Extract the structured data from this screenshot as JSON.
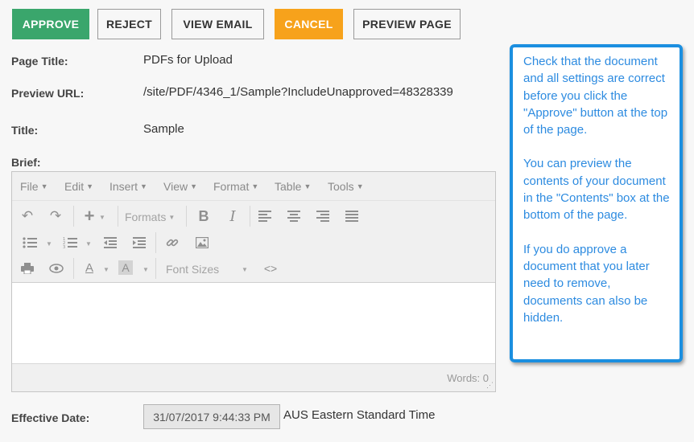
{
  "toolbar": {
    "approve": "APPROVE",
    "reject": "REJECT",
    "view_email": "VIEW EMAIL",
    "cancel": "CANCEL",
    "preview_page": "PREVIEW PAGE"
  },
  "fields": {
    "page_title_label": "Page Title:",
    "page_title_value": "PDFs for Upload",
    "preview_url_label": "Preview URL:",
    "preview_url_value": "/site/PDF/4346_1/Sample?IncludeUnapproved=48328339",
    "title_label": "Title:",
    "title_value": "Sample",
    "brief_label": "Brief:",
    "effective_date_label": "Effective Date:",
    "effective_date_value": "31/07/2017 9:44:33 PM",
    "timezone": "AUS Eastern Standard Time"
  },
  "editor": {
    "menus": [
      "File",
      "Edit",
      "Insert",
      "View",
      "Format",
      "Table",
      "Tools"
    ],
    "formats_label": "Formats",
    "font_sizes_label": "Font Sizes",
    "bold": "B",
    "italic": "I",
    "text_color": "A",
    "bg_color": "A",
    "code": "<>",
    "word_count": "Words: 0"
  },
  "help": {
    "paragraphs": [
      "Check that the document and all settings are correct before you click the \"Approve\" button at the top of the page.",
      "You can preview the contents of your document in the \"Contents\" box at the bottom of the page.",
      "If you do approve a document that you later need to remove, documents can also be hidden."
    ]
  },
  "colors": {
    "approve": "#3aa66c",
    "cancel": "#f7a21b",
    "help_border": "#1b8fe0",
    "help_text": "#2d8be0"
  }
}
